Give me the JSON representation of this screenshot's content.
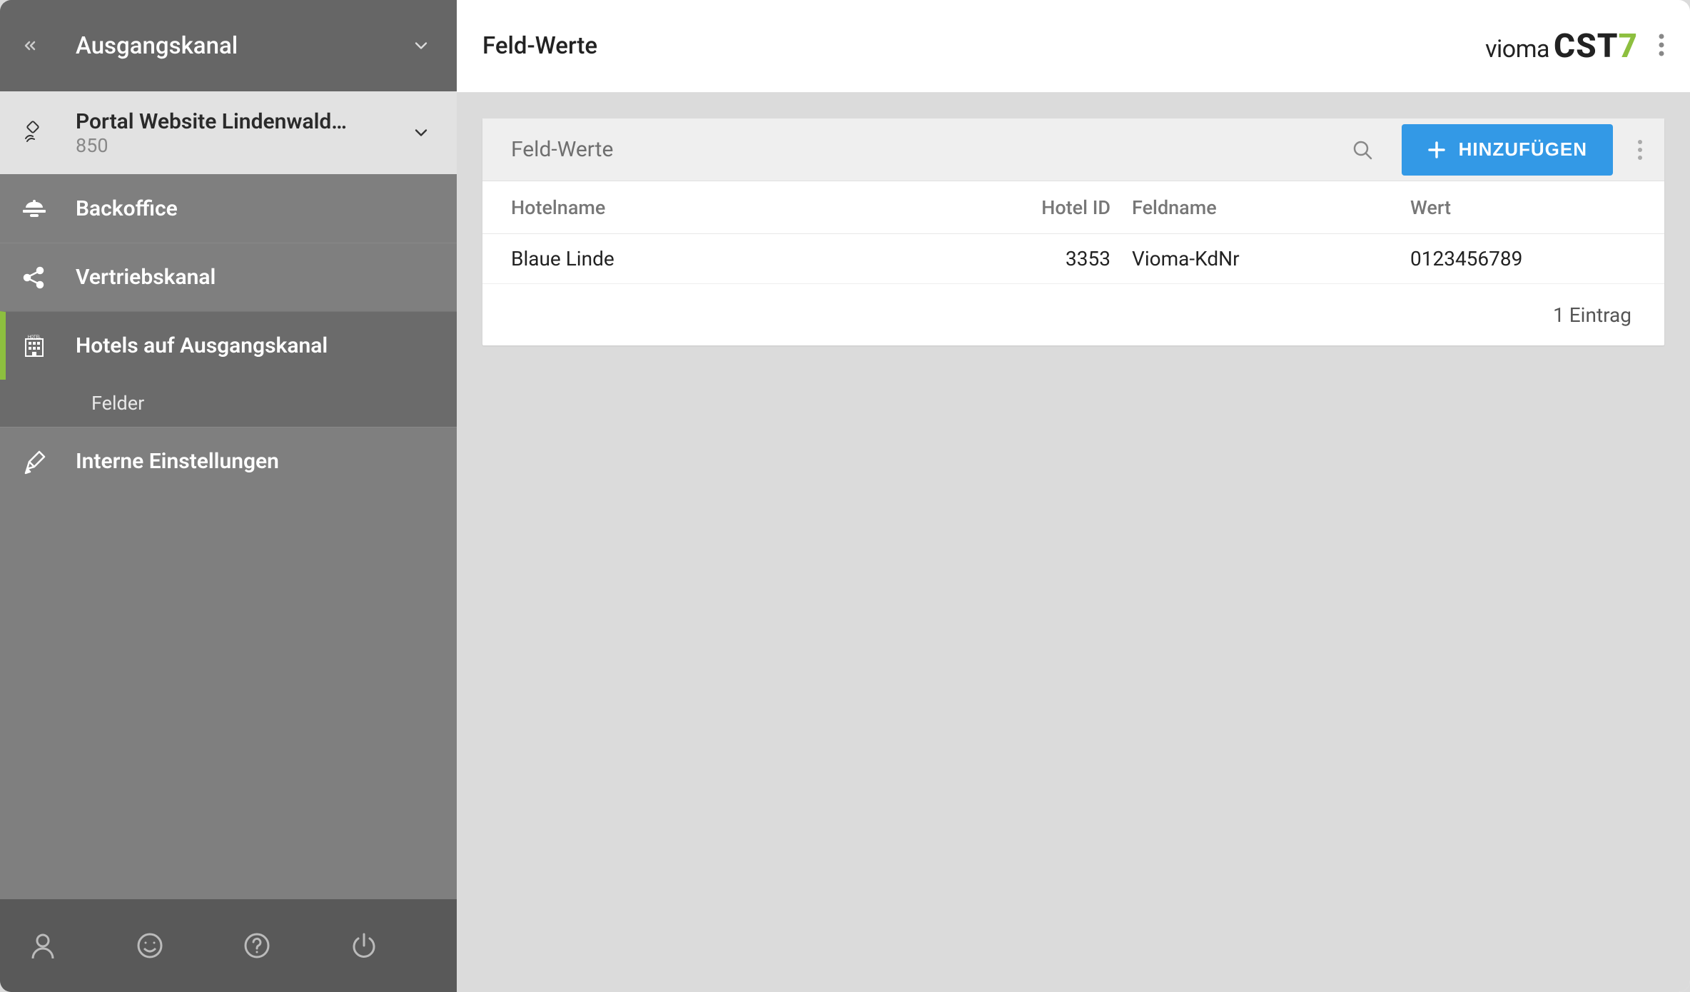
{
  "sidebar": {
    "header_title": "Ausgangskanal",
    "portal": {
      "name": "Portal Website Lindenwald…",
      "id": "850"
    },
    "items": [
      {
        "label": "Backoffice"
      },
      {
        "label": "Vertriebskanal"
      },
      {
        "label": "Hotels auf Ausgangskanal"
      },
      {
        "label": "Interne Einstellungen"
      }
    ],
    "sub_item": "Felder"
  },
  "header": {
    "title": "Feld-Werte",
    "brand_vioma": "vioma",
    "brand_cst": "CST",
    "brand_7": "7"
  },
  "card": {
    "title": "Feld-Werte",
    "add_label": "HINZUFÜGEN"
  },
  "table": {
    "columns": {
      "hotelname": "Hotelname",
      "hotelid": "Hotel ID",
      "feldname": "Feldname",
      "wert": "Wert"
    },
    "rows": [
      {
        "hotelname": "Blaue Linde",
        "hotelid": "3353",
        "feldname": "Vioma-KdNr",
        "wert": "0123456789"
      }
    ],
    "footer": "1 Eintrag"
  }
}
